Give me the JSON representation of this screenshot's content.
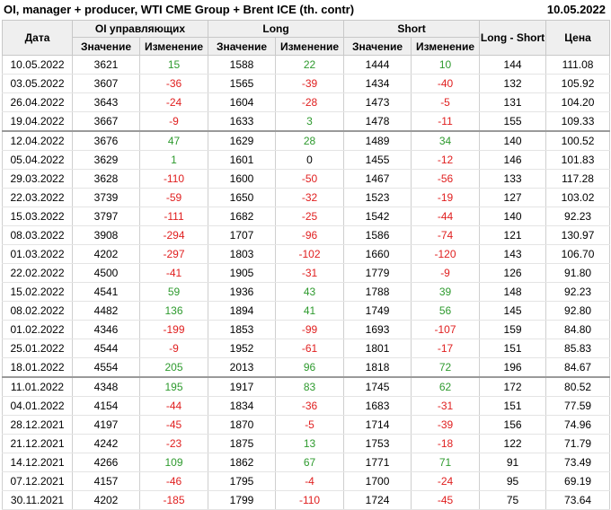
{
  "header": {
    "title": "OI, manager + producer, WTI CME Group + Brent ICE (th. contr)",
    "date": "10.05.2022"
  },
  "columns": {
    "date": "Дата",
    "oi_group": "OI управляющих",
    "long_group": "Long",
    "short_group": "Short",
    "long_short": "Long - Short",
    "price": "Цена",
    "value": "Значение",
    "change": "Изменение"
  },
  "rows": [
    {
      "date": "10.05.2022",
      "oi": "3621",
      "oi_chg": "15",
      "long": "1588",
      "long_chg": "22",
      "short": "1444",
      "short_chg": "10",
      "ls": "144",
      "price": "111.08"
    },
    {
      "date": "03.05.2022",
      "oi": "3607",
      "oi_chg": "-36",
      "long": "1565",
      "long_chg": "-39",
      "short": "1434",
      "short_chg": "-40",
      "ls": "132",
      "price": "105.92"
    },
    {
      "date": "26.04.2022",
      "oi": "3643",
      "oi_chg": "-24",
      "long": "1604",
      "long_chg": "-28",
      "short": "1473",
      "short_chg": "-5",
      "ls": "131",
      "price": "104.20"
    },
    {
      "date": "19.04.2022",
      "oi": "3667",
      "oi_chg": "-9",
      "long": "1633",
      "long_chg": "3",
      "short": "1478",
      "short_chg": "-11",
      "ls": "155",
      "price": "109.33"
    },
    {
      "date": "12.04.2022",
      "oi": "3676",
      "oi_chg": "47",
      "long": "1629",
      "long_chg": "28",
      "short": "1489",
      "short_chg": "34",
      "ls": "140",
      "price": "100.52"
    },
    {
      "date": "05.04.2022",
      "oi": "3629",
      "oi_chg": "1",
      "long": "1601",
      "long_chg": "0",
      "short": "1455",
      "short_chg": "-12",
      "ls": "146",
      "price": "101.83"
    },
    {
      "date": "29.03.2022",
      "oi": "3628",
      "oi_chg": "-110",
      "long": "1600",
      "long_chg": "-50",
      "short": "1467",
      "short_chg": "-56",
      "ls": "133",
      "price": "117.28"
    },
    {
      "date": "22.03.2022",
      "oi": "3739",
      "oi_chg": "-59",
      "long": "1650",
      "long_chg": "-32",
      "short": "1523",
      "short_chg": "-19",
      "ls": "127",
      "price": "103.02"
    },
    {
      "date": "15.03.2022",
      "oi": "3797",
      "oi_chg": "-111",
      "long": "1682",
      "long_chg": "-25",
      "short": "1542",
      "short_chg": "-44",
      "ls": "140",
      "price": "92.23"
    },
    {
      "date": "08.03.2022",
      "oi": "3908",
      "oi_chg": "-294",
      "long": "1707",
      "long_chg": "-96",
      "short": "1586",
      "short_chg": "-74",
      "ls": "121",
      "price": "130.97"
    },
    {
      "date": "01.03.2022",
      "oi": "4202",
      "oi_chg": "-297",
      "long": "1803",
      "long_chg": "-102",
      "short": "1660",
      "short_chg": "-120",
      "ls": "143",
      "price": "106.70"
    },
    {
      "date": "22.02.2022",
      "oi": "4500",
      "oi_chg": "-41",
      "long": "1905",
      "long_chg": "-31",
      "short": "1779",
      "short_chg": "-9",
      "ls": "126",
      "price": "91.80"
    },
    {
      "date": "15.02.2022",
      "oi": "4541",
      "oi_chg": "59",
      "long": "1936",
      "long_chg": "43",
      "short": "1788",
      "short_chg": "39",
      "ls": "148",
      "price": "92.23"
    },
    {
      "date": "08.02.2022",
      "oi": "4482",
      "oi_chg": "136",
      "long": "1894",
      "long_chg": "41",
      "short": "1749",
      "short_chg": "56",
      "ls": "145",
      "price": "92.80"
    },
    {
      "date": "01.02.2022",
      "oi": "4346",
      "oi_chg": "-199",
      "long": "1853",
      "long_chg": "-99",
      "short": "1693",
      "short_chg": "-107",
      "ls": "159",
      "price": "84.80"
    },
    {
      "date": "25.01.2022",
      "oi": "4544",
      "oi_chg": "-9",
      "long": "1952",
      "long_chg": "-61",
      "short": "1801",
      "short_chg": "-17",
      "ls": "151",
      "price": "85.83"
    },
    {
      "date": "18.01.2022",
      "oi": "4554",
      "oi_chg": "205",
      "long": "2013",
      "long_chg": "96",
      "short": "1818",
      "short_chg": "72",
      "ls": "196",
      "price": "84.67"
    },
    {
      "date": "11.01.2022",
      "oi": "4348",
      "oi_chg": "195",
      "long": "1917",
      "long_chg": "83",
      "short": "1745",
      "short_chg": "62",
      "ls": "172",
      "price": "80.52"
    },
    {
      "date": "04.01.2022",
      "oi": "4154",
      "oi_chg": "-44",
      "long": "1834",
      "long_chg": "-36",
      "short": "1683",
      "short_chg": "-31",
      "ls": "151",
      "price": "77.59"
    },
    {
      "date": "28.12.2021",
      "oi": "4197",
      "oi_chg": "-45",
      "long": "1870",
      "long_chg": "-5",
      "short": "1714",
      "short_chg": "-39",
      "ls": "156",
      "price": "74.96"
    },
    {
      "date": "21.12.2021",
      "oi": "4242",
      "oi_chg": "-23",
      "long": "1875",
      "long_chg": "13",
      "short": "1753",
      "short_chg": "-18",
      "ls": "122",
      "price": "71.79"
    },
    {
      "date": "14.12.2021",
      "oi": "4266",
      "oi_chg": "109",
      "long": "1862",
      "long_chg": "67",
      "short": "1771",
      "short_chg": "71",
      "ls": "91",
      "price": "73.49"
    },
    {
      "date": "07.12.2021",
      "oi": "4157",
      "oi_chg": "-46",
      "long": "1795",
      "long_chg": "-4",
      "short": "1700",
      "short_chg": "-24",
      "ls": "95",
      "price": "69.19"
    },
    {
      "date": "30.11.2021",
      "oi": "4202",
      "oi_chg": "-185",
      "long": "1799",
      "long_chg": "-110",
      "short": "1724",
      "short_chg": "-45",
      "ls": "75",
      "price": "73.64"
    }
  ],
  "colors": {
    "positive": "#2e9a2e",
    "negative": "#e02020",
    "header_bg": "#efefef"
  }
}
